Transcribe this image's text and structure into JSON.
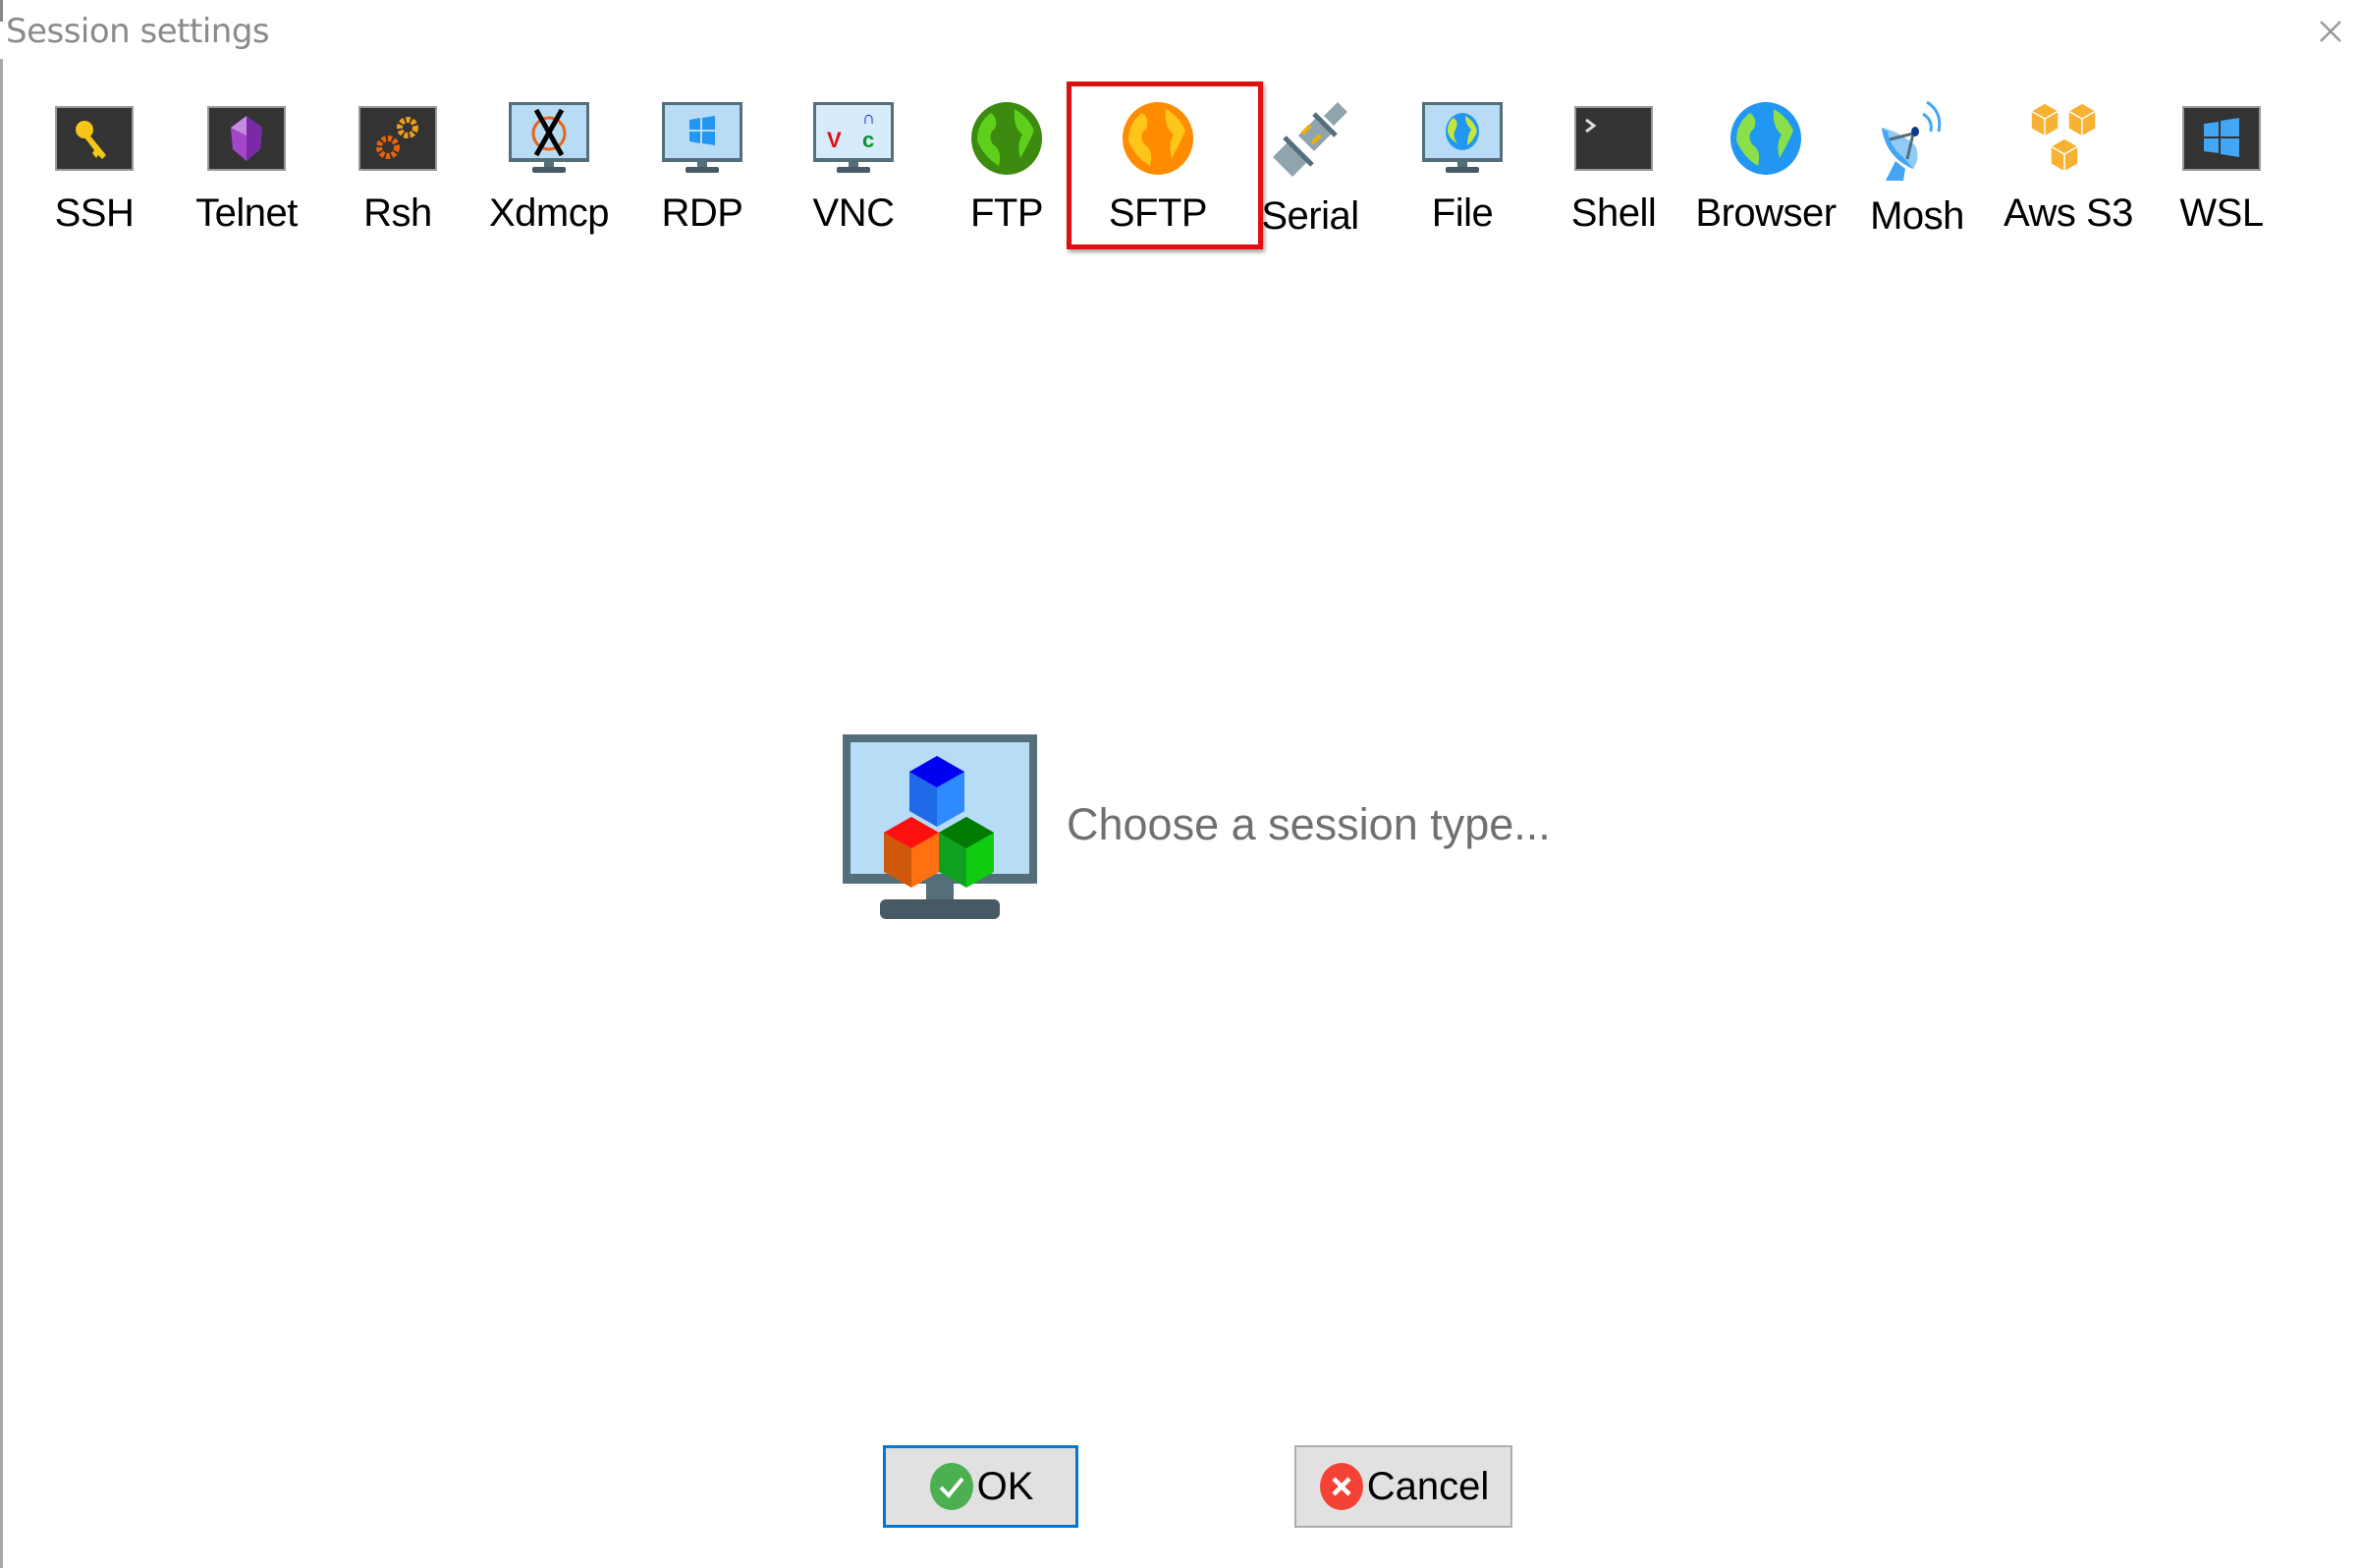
{
  "window": {
    "title": "Session settings",
    "close_icon": "close-icon"
  },
  "session_types": [
    {
      "id": "ssh",
      "label": "SSH",
      "icon": "key-icon"
    },
    {
      "id": "telnet",
      "label": "Telnet",
      "icon": "crystal-icon"
    },
    {
      "id": "rsh",
      "label": "Rsh",
      "icon": "gears-icon"
    },
    {
      "id": "xdmcp",
      "label": "Xdmcp",
      "icon": "x-monitor-icon"
    },
    {
      "id": "rdp",
      "label": "RDP",
      "icon": "windows-monitor-icon"
    },
    {
      "id": "vnc",
      "label": "VNC",
      "icon": "vnc-monitor-icon"
    },
    {
      "id": "ftp",
      "label": "FTP",
      "icon": "green-globe-icon"
    },
    {
      "id": "sftp",
      "label": "SFTP",
      "icon": "orange-globe-icon"
    },
    {
      "id": "serial",
      "label": "Serial",
      "icon": "plug-icon"
    },
    {
      "id": "file",
      "label": "File",
      "icon": "globe-monitor-icon"
    },
    {
      "id": "shell",
      "label": "Shell",
      "icon": "terminal-icon"
    },
    {
      "id": "browser",
      "label": "Browser",
      "icon": "blue-globe-icon"
    },
    {
      "id": "mosh",
      "label": "Mosh",
      "icon": "satellite-dish-icon"
    },
    {
      "id": "awss3",
      "label": "Aws S3",
      "icon": "boxes-icon"
    },
    {
      "id": "wsl",
      "label": "WSL",
      "icon": "windows-logo-icon"
    }
  ],
  "highlighted_type": "SFTP",
  "highlight_color": "#e01010",
  "placeholder": {
    "icon": "session-cubes-monitor-icon",
    "text": "Choose a session type..."
  },
  "buttons": {
    "ok_label": "OK",
    "cancel_label": "Cancel",
    "ok_icon": "check-circle-icon",
    "cancel_icon": "x-circle-icon",
    "focus_color": "#0078d7"
  }
}
